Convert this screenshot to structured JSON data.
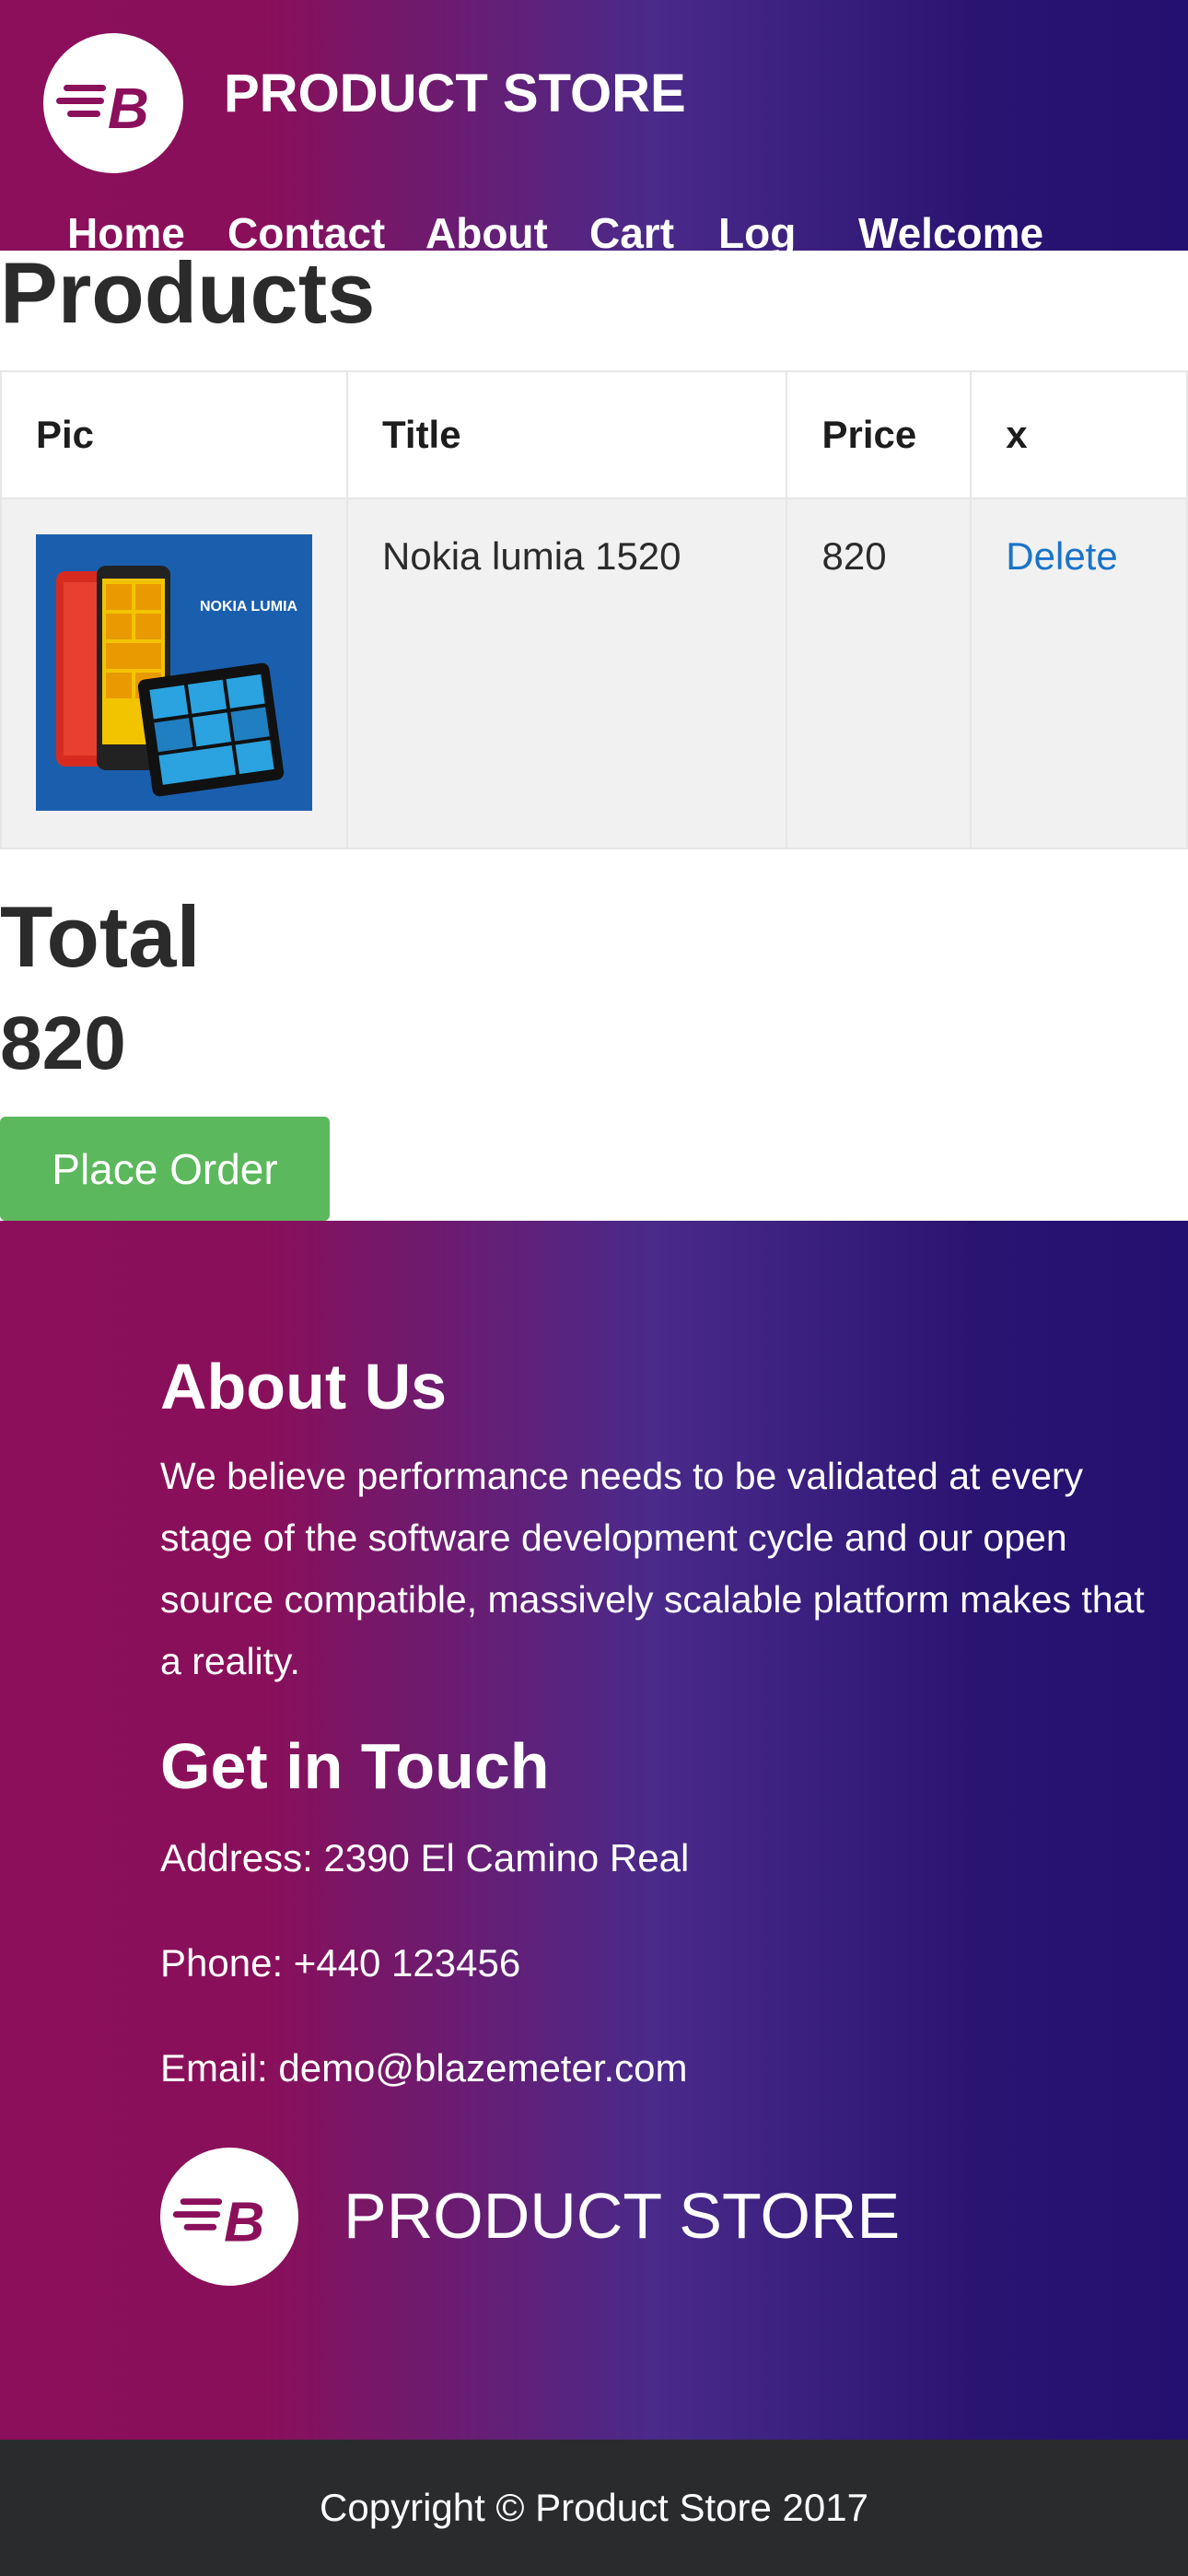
{
  "header": {
    "brand": "PRODUCT STORE",
    "nav": [
      "Home",
      "Contact",
      "About",
      "Cart",
      "Log",
      "Welcome"
    ]
  },
  "products": {
    "title": "Products",
    "columns": [
      "Pic",
      "Title",
      "Price",
      "x"
    ],
    "rows": [
      {
        "title": "Nokia lumia 1520",
        "price": "820",
        "action": "Delete",
        "image_caption": "NOKIA LUMIA"
      }
    ]
  },
  "total": {
    "label": "Total",
    "value": "820"
  },
  "place_order_label": "Place Order",
  "footer": {
    "about_title": "About Us",
    "about_text": "We believe performance needs to be validated at every stage of the software development cycle and our open source compatible, massively scalable platform makes that a reality.",
    "touch_title": "Get in Touch",
    "address": "Address: 2390 El Camino Real",
    "phone": "Phone: +440 123456",
    "email": "Email: demo@blazemeter.com",
    "brand": "PRODUCT STORE",
    "copyright": "Copyright © Product Store 2017"
  },
  "colors": {
    "gradient_left": "#8b0f5a",
    "gradient_right": "#241070",
    "accent_green": "#5cb85c",
    "link_blue": "#1a73c8",
    "copyright_bg": "#2a2b2d"
  },
  "icons": {
    "logo": "blazemeter-b-logo-icon"
  }
}
